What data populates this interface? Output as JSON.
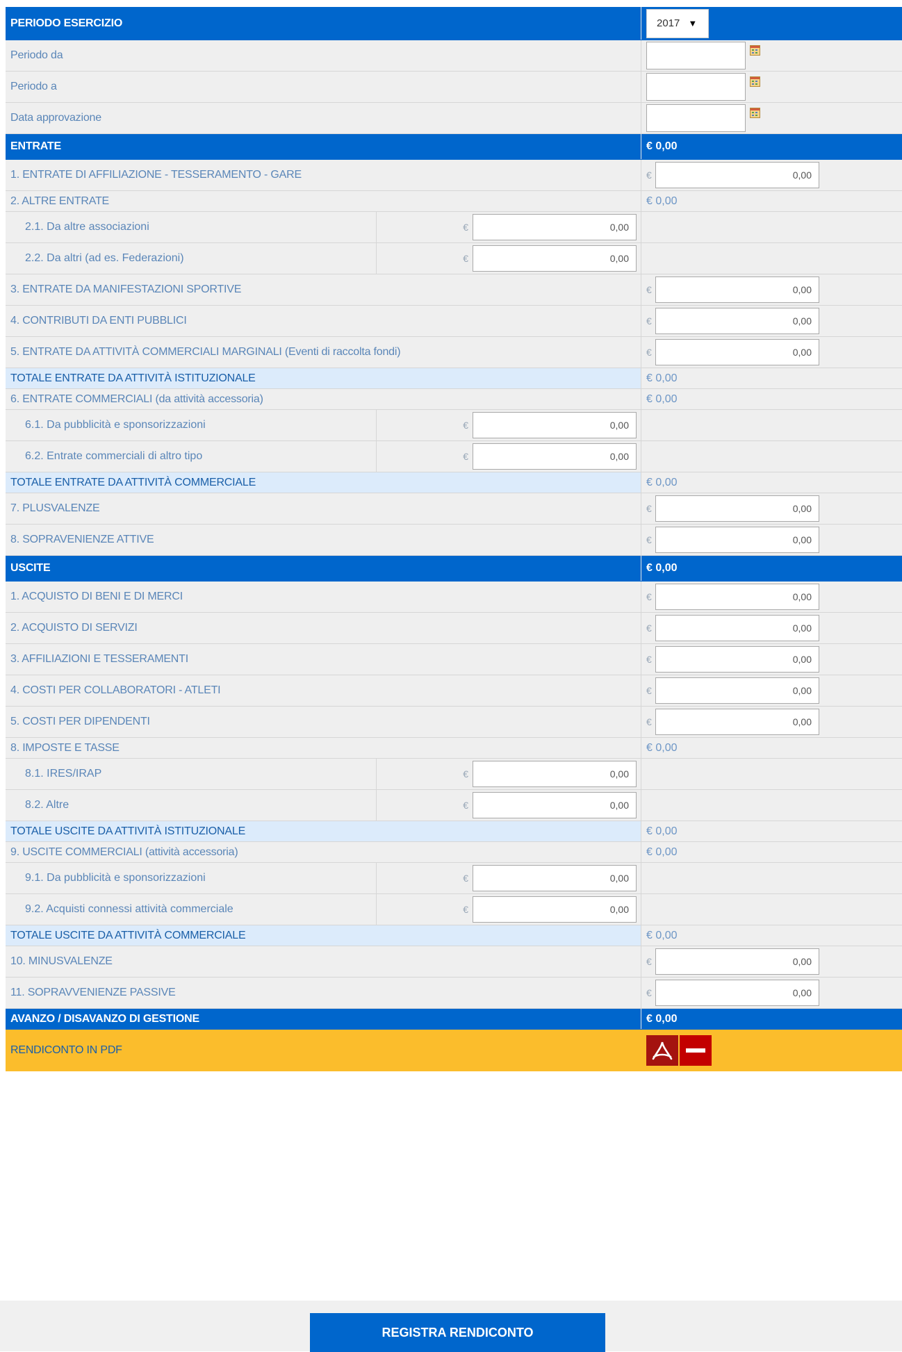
{
  "periodo": {
    "header_label": "PERIODO ESERCIZIO",
    "year_selected": "2017",
    "rows": [
      {
        "label": "Periodo da"
      },
      {
        "label": "Periodo a"
      },
      {
        "label": "Data approvazione"
      }
    ]
  },
  "entrate": {
    "header_label": "ENTRATE",
    "header_total": "€ 0,00",
    "items": {
      "r1": {
        "label": "1. ENTRATE DI AFFILIAZIONE - TESSERAMENTO - GARE",
        "value": "0,00"
      },
      "r2": {
        "label": "2. ALTRE ENTRATE",
        "total": "€ 0,00"
      },
      "r2_1": {
        "label": "2.1. Da altre associazioni",
        "value": "0,00"
      },
      "r2_2": {
        "label": "2.2. Da altri (ad es. Federazioni)",
        "value": "0,00"
      },
      "r3": {
        "label": "3. ENTRATE DA MANIFESTAZIONI SPORTIVE",
        "value": "0,00"
      },
      "r4": {
        "label": "4. CONTRIBUTI DA ENTI PUBBLICI",
        "value": "0,00"
      },
      "r5": {
        "label": "5. ENTRATE DA ATTIVITÀ COMMERCIALI MARGINALI (Eventi di raccolta fondi)",
        "value": "0,00"
      },
      "tot_ist": {
        "label": "TOTALE ENTRATE DA ATTIVITÀ ISTITUZIONALE",
        "total": "€ 0,00"
      },
      "r6": {
        "label": "6. ENTRATE COMMERCIALI (da attività accessoria)",
        "total": "€ 0,00"
      },
      "r6_1": {
        "label": "6.1. Da pubblicità e sponsorizzazioni",
        "value": "0,00"
      },
      "r6_2": {
        "label": "6.2. Entrate commerciali di altro tipo",
        "value": "0,00"
      },
      "tot_comm": {
        "label": "TOTALE ENTRATE DA ATTIVITÀ COMMERCIALE",
        "total": "€ 0,00"
      },
      "r7": {
        "label": "7. PLUSVALENZE",
        "value": "0,00"
      },
      "r8": {
        "label": "8. SOPRAVENIENZE ATTIVE",
        "value": "0,00"
      }
    }
  },
  "uscite": {
    "header_label": "USCITE",
    "header_total": "€ 0,00",
    "items": {
      "r1": {
        "label": "1. ACQUISTO DI BENI E DI MERCI",
        "value": "0,00"
      },
      "r2": {
        "label": "2. ACQUISTO DI SERVIZI",
        "value": "0,00"
      },
      "r3": {
        "label": "3. AFFILIAZIONI E TESSERAMENTI",
        "value": "0,00"
      },
      "r4": {
        "label": "4. COSTI PER COLLABORATORI - ATLETI",
        "value": "0,00"
      },
      "r5": {
        "label": "5. COSTI PER DIPENDENTI",
        "value": "0,00"
      },
      "r8": {
        "label": "8. IMPOSTE E TASSE",
        "total": "€ 0,00"
      },
      "r8_1": {
        "label": "8.1. IRES/IRAP",
        "value": "0,00"
      },
      "r8_2": {
        "label": "8.2. Altre",
        "value": "0,00"
      },
      "tot_ist": {
        "label": "TOTALE USCITE DA ATTIVITÀ ISTITUZIONALE",
        "total": "€ 0,00"
      },
      "r9": {
        "label": "9. USCITE COMMERCIALI (attività accessoria)",
        "total": "€ 0,00"
      },
      "r9_1": {
        "label": "9.1. Da pubblicità e sponsorizzazioni",
        "value": "0,00"
      },
      "r9_2": {
        "label": "9.2. Acquisti connessi attività commerciale",
        "value": "0,00"
      },
      "tot_comm": {
        "label": "TOTALE USCITE DA ATTIVITÀ COMMERCIALE",
        "total": "€ 0,00"
      },
      "r10": {
        "label": "10. MINUSVALENZE",
        "value": "0,00"
      },
      "r11": {
        "label": "11. SOPRAVVENIENZE PASSIVE",
        "value": "0,00"
      }
    }
  },
  "avanzo": {
    "label": "AVANZO / DISAVANZO DI GESTIONE",
    "total": "€ 0,00"
  },
  "pdf": {
    "label": "RENDICONTO IN PDF"
  },
  "currency_symbol": "€",
  "actions": {
    "save_label": "REGISTRA RENDICONTO"
  },
  "colors": {
    "header_blue": "#0066cc",
    "total_row_bg": "#dcebfb",
    "pdf_row_bg": "#fbbd2c",
    "row_bg": "#efefef"
  }
}
